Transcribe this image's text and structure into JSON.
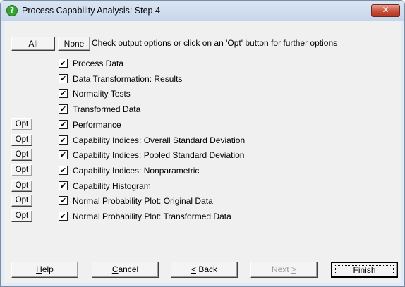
{
  "window": {
    "title": "Process Capability Analysis: Step 4",
    "close_glyph": "✕",
    "icon": "question-circle-icon"
  },
  "top": {
    "all_label": "All",
    "none_label": "None",
    "instruction": "Check output options or click on an 'Opt' button for further options"
  },
  "options": [
    {
      "label": "Process Data",
      "checked": true,
      "has_opt": false
    },
    {
      "label": "Data Transformation: Results",
      "checked": true,
      "has_opt": false
    },
    {
      "label": "Normality Tests",
      "checked": true,
      "has_opt": false
    },
    {
      "label": "Transformed Data",
      "checked": true,
      "has_opt": false
    },
    {
      "label": "Performance",
      "checked": true,
      "has_opt": true
    },
    {
      "label": "Capability Indices: Overall Standard Deviation",
      "checked": true,
      "has_opt": true
    },
    {
      "label": "Capability Indices: Pooled Standard Deviation",
      "checked": true,
      "has_opt": true
    },
    {
      "label": "Capability Indices: Nonparametric",
      "checked": true,
      "has_opt": true
    },
    {
      "label": "Capability Histogram",
      "checked": true,
      "has_opt": true
    },
    {
      "label": "Normal Probability Plot: Original Data",
      "checked": true,
      "has_opt": true
    },
    {
      "label": "Normal Probability Plot: Transformed Data",
      "checked": true,
      "has_opt": true
    }
  ],
  "opt_label": "Opt",
  "check_glyph": "✔",
  "buttons": {
    "help": {
      "mnemonic": "H",
      "rest": "elp"
    },
    "cancel": {
      "mnemonic": "C",
      "rest": "ancel"
    },
    "back": {
      "mnemonic": "<",
      "rest": " Back"
    },
    "next": {
      "text": "Next",
      "mnemonic": ">"
    },
    "finish": {
      "mnemonic": "F",
      "rest": "inish"
    }
  }
}
